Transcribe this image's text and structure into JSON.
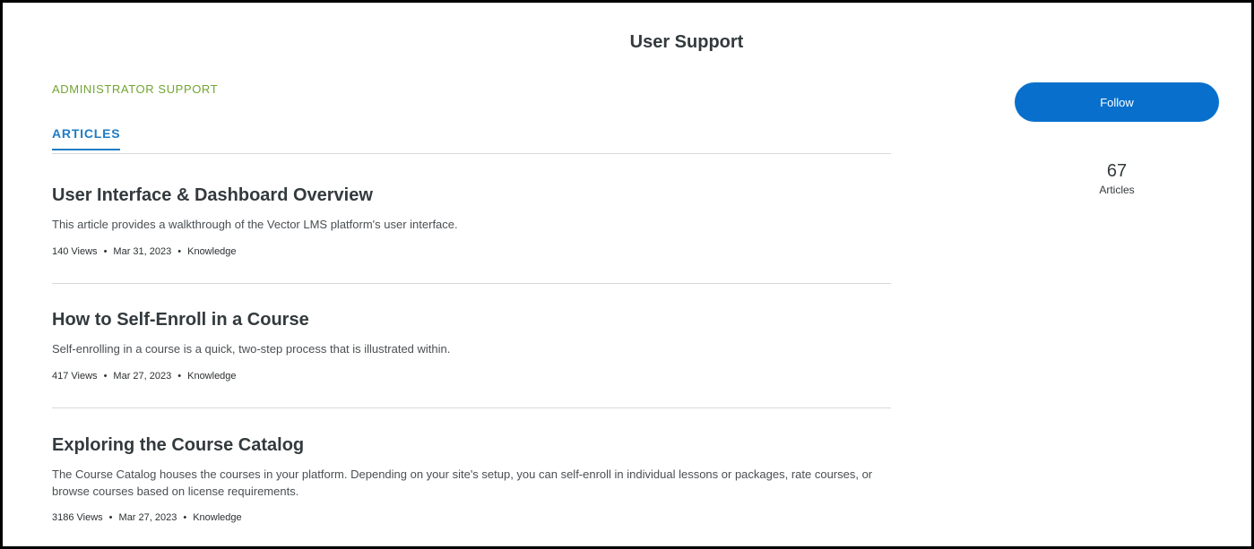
{
  "page": {
    "title": "User Support"
  },
  "section": {
    "label": "ADMINISTRATOR SUPPORT"
  },
  "tabs": [
    {
      "label": "ARTICLES",
      "active": true
    }
  ],
  "articles": [
    {
      "title": "User Interface & Dashboard Overview",
      "description": "This article provides a walkthrough of the Vector LMS platform's user interface.",
      "views": "140 Views",
      "date": "Mar 31, 2023",
      "type": "Knowledge"
    },
    {
      "title": "How to Self-Enroll in a Course",
      "description": "Self-enrolling in a course is a quick, two-step process that is illustrated within.",
      "views": "417 Views",
      "date": "Mar 27, 2023",
      "type": "Knowledge"
    },
    {
      "title": "Exploring the Course Catalog",
      "description": "The Course Catalog houses the courses in your platform. Depending on your site's setup, you can self-enroll in individual lessons or packages, rate courses, or browse courses based on license requirements.",
      "views": "3186 Views",
      "date": "Mar 27, 2023",
      "type": "Knowledge"
    }
  ],
  "sidebar": {
    "follow_label": "Follow",
    "article_count": "67",
    "article_count_label": "Articles"
  },
  "meta_separator": "•",
  "colors": {
    "accent_blue": "#0870cc",
    "tab_blue": "#1f7cc4",
    "section_green": "#73a532",
    "text_dark": "#333a3d"
  }
}
